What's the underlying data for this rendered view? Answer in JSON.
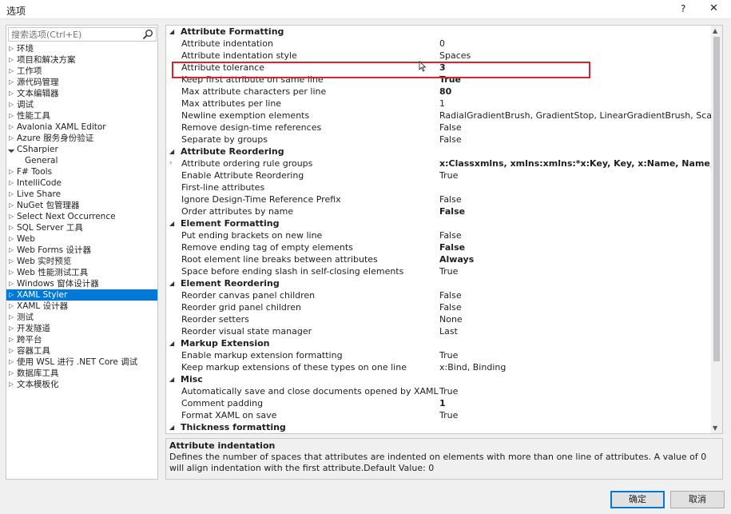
{
  "window": {
    "title": "选项",
    "help_label": "?",
    "close_label": "✕"
  },
  "search": {
    "placeholder": "搜索选项(Ctrl+E)"
  },
  "tree": [
    {
      "label": "环境",
      "kind": "collapsed"
    },
    {
      "label": "项目和解决方案",
      "kind": "collapsed"
    },
    {
      "label": "工作项",
      "kind": "collapsed"
    },
    {
      "label": "源代码管理",
      "kind": "collapsed"
    },
    {
      "label": "文本编辑器",
      "kind": "collapsed"
    },
    {
      "label": "调试",
      "kind": "collapsed"
    },
    {
      "label": "性能工具",
      "kind": "collapsed"
    },
    {
      "label": "Avalonia XAML Editor",
      "kind": "collapsed"
    },
    {
      "label": "Azure 服务身份验证",
      "kind": "collapsed"
    },
    {
      "label": "CSharpier",
      "kind": "open"
    },
    {
      "label": "General",
      "kind": "child"
    },
    {
      "label": "F# Tools",
      "kind": "collapsed"
    },
    {
      "label": "IntelliCode",
      "kind": "collapsed"
    },
    {
      "label": "Live Share",
      "kind": "collapsed"
    },
    {
      "label": "NuGet 包管理器",
      "kind": "collapsed"
    },
    {
      "label": "Select Next Occurrence",
      "kind": "collapsed"
    },
    {
      "label": "SQL Server 工具",
      "kind": "collapsed"
    },
    {
      "label": "Web",
      "kind": "collapsed"
    },
    {
      "label": "Web Forms 设计器",
      "kind": "collapsed"
    },
    {
      "label": "Web 实时预览",
      "kind": "collapsed"
    },
    {
      "label": "Web 性能测试工具",
      "kind": "collapsed"
    },
    {
      "label": "Windows 窗体设计器",
      "kind": "collapsed"
    },
    {
      "label": "XAML Styler",
      "kind": "selected"
    },
    {
      "label": "XAML 设计器",
      "kind": "collapsed"
    },
    {
      "label": "测试",
      "kind": "collapsed"
    },
    {
      "label": "开发隧道",
      "kind": "collapsed"
    },
    {
      "label": "跨平台",
      "kind": "collapsed"
    },
    {
      "label": "容器工具",
      "kind": "collapsed"
    },
    {
      "label": "使用 WSL 进行 .NET Core 调试",
      "kind": "collapsed"
    },
    {
      "label": "数据库工具",
      "kind": "collapsed"
    },
    {
      "label": "文本模板化",
      "kind": "collapsed"
    }
  ],
  "grid": [
    {
      "type": "category",
      "label": "Attribute Formatting"
    },
    {
      "type": "prop",
      "name": "Attribute indentation",
      "value": "0",
      "bold": false
    },
    {
      "type": "prop",
      "name": "Attribute indentation style",
      "value": "Spaces",
      "bold": false
    },
    {
      "type": "prop",
      "name": "Attribute tolerance",
      "value": "3",
      "bold": true
    },
    {
      "type": "prop",
      "name": "Keep first attribute on same line",
      "value": "True",
      "bold": true
    },
    {
      "type": "prop",
      "name": "Max attribute characters per line",
      "value": "80",
      "bold": true
    },
    {
      "type": "prop",
      "name": "Max attributes per line",
      "value": "1",
      "bold": false
    },
    {
      "type": "prop",
      "name": "Newline exemption elements",
      "value": "RadialGradientBrush, GradientStop, LinearGradientBrush, ScaleTran",
      "bold": false
    },
    {
      "type": "prop",
      "name": "Remove design-time references",
      "value": "False",
      "bold": false
    },
    {
      "type": "prop",
      "name": "Separate by groups",
      "value": "False",
      "bold": false
    },
    {
      "type": "category",
      "label": "Attribute Reordering"
    },
    {
      "type": "prop",
      "name": "Attribute ordering rule groups",
      "value": "x:Class​xmlns, xmlns:xmlns:*x:Key, Key, x:Name, Name, x:Uid, Ui",
      "bold": true,
      "expandable": true
    },
    {
      "type": "prop",
      "name": "Enable Attribute Reordering",
      "value": "True",
      "bold": false
    },
    {
      "type": "prop",
      "name": "First-line attributes",
      "value": "",
      "bold": false
    },
    {
      "type": "prop",
      "name": "Ignore Design-Time Reference Prefix",
      "value": "False",
      "bold": false
    },
    {
      "type": "prop",
      "name": "Order attributes by name",
      "value": "False",
      "bold": true
    },
    {
      "type": "category",
      "label": "Element Formatting"
    },
    {
      "type": "prop",
      "name": "Put ending brackets on new line",
      "value": "False",
      "bold": false
    },
    {
      "type": "prop",
      "name": "Remove ending tag of empty elements",
      "value": "False",
      "bold": true
    },
    {
      "type": "prop",
      "name": "Root element line breaks between attributes",
      "value": "Always",
      "bold": true
    },
    {
      "type": "prop",
      "name": "Space before ending slash in self-closing elements",
      "value": "True",
      "bold": false
    },
    {
      "type": "category",
      "label": "Element Reordering"
    },
    {
      "type": "prop",
      "name": "Reorder canvas panel children",
      "value": "False",
      "bold": false
    },
    {
      "type": "prop",
      "name": "Reorder grid panel children",
      "value": "False",
      "bold": false
    },
    {
      "type": "prop",
      "name": "Reorder setters",
      "value": "None",
      "bold": false
    },
    {
      "type": "prop",
      "name": "Reorder visual state manager",
      "value": "Last",
      "bold": false
    },
    {
      "type": "category",
      "label": "Markup Extension"
    },
    {
      "type": "prop",
      "name": "Enable markup extension formatting",
      "value": "True",
      "bold": false
    },
    {
      "type": "prop",
      "name": "Keep markup extensions of these types on one line",
      "value": "x:Bind, Binding",
      "bold": false
    },
    {
      "type": "category",
      "label": "Misc"
    },
    {
      "type": "prop",
      "name": "Automatically save and close documents opened by XAML Style",
      "value": "True",
      "bold": false
    },
    {
      "type": "prop",
      "name": "Comment padding",
      "value": "1",
      "bold": true
    },
    {
      "type": "prop",
      "name": "Format XAML on save",
      "value": "True",
      "bold": false
    },
    {
      "type": "category",
      "label": "Thickness formatting"
    }
  ],
  "description": {
    "title": "Attribute indentation",
    "text": "Defines the number of spaces that attributes are indented on elements with more than one line of attributes. A value of 0 will align indentation with the first attribute.Default Value: 0"
  },
  "buttons": {
    "ok": "确定",
    "cancel": "取消"
  },
  "colors": {
    "selection": "#0078d7",
    "highlight_box": "#d9242f"
  }
}
